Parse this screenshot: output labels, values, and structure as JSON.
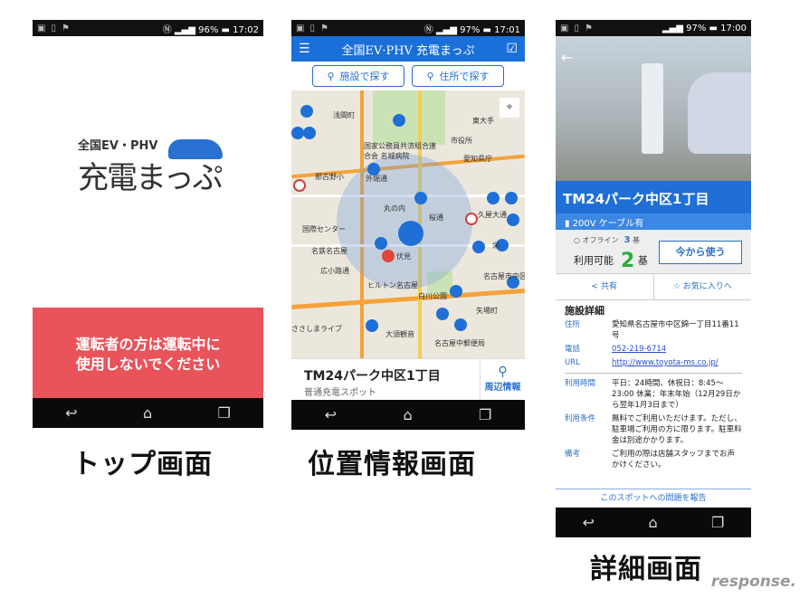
{
  "screens": {
    "top": {
      "status": {
        "battery": "96%",
        "time": "17:02"
      },
      "logo_small": "全国EV・PHV",
      "logo_big": "充電まっぷ",
      "warning": [
        "運転者の方は運転中に",
        "使用しないでください"
      ],
      "caption": "トップ画面"
    },
    "map": {
      "status": {
        "battery": "97%",
        "time": "17:01"
      },
      "header_title": "全国EV·PHV 充電まっぷ",
      "search_facility": "施設で探す",
      "search_address": "住所で探す",
      "map_labels": [
        "浅間町",
        "市役所",
        "国家公務員共済組合連合会 名城病院",
        "愛知県庁",
        "那古野小",
        "外堀通",
        "丸の内",
        "桜通",
        "久屋大通",
        "国際センター",
        "名鉄名古屋",
        "伏見",
        "広小路通",
        "名古屋市中区",
        "ヒルトン名古屋",
        "白川公園",
        "矢場町",
        "ささしまライブ",
        "大須観音",
        "名古屋中郵便局",
        "東大手",
        "栄"
      ],
      "spot_name": "TM24パーク中区1丁目",
      "spot_type": "普通充電スポット",
      "nearby": "周辺情報",
      "caption": "位置情報画面"
    },
    "detail": {
      "status": {
        "battery": "97%",
        "time": "17:00"
      },
      "title": "TM24パーク中区1丁目",
      "charger": "200V ケーブル有",
      "offline_label": "オフライン",
      "offline_count": "3",
      "unit": "基",
      "available_label": "利用可能",
      "available_count": "2",
      "use_now": "今から使う",
      "share": "共有",
      "favorite": "お気に入りへ",
      "section": "施設詳細",
      "rows": [
        {
          "k": "住所",
          "v": "愛知県名古屋市中区錦一丁目11番11号"
        },
        {
          "k": "電話",
          "v": "052-219-6714",
          "link": true
        },
        {
          "k": "URL",
          "v": "http://www.toyota-ms.co.jp/",
          "link": true
        },
        {
          "k": "利用時間",
          "v": "平日：24時間、休祝日：8:45〜23:00 休業：年末年始（12月29日から翌年1月3日まで）"
        },
        {
          "k": "利用条件",
          "v": "無料でご利用いただけます。ただし、駐車場ご利用の方に限ります。駐車料金は別途かかります。"
        },
        {
          "k": "備考",
          "v": "ご利用の際は店舗スタッフまでお声かけください。"
        }
      ],
      "report": "このスポットへの問題を報告",
      "caption": "詳細画面"
    }
  },
  "watermark": "response.",
  "colors": {
    "primary": "#1f6fd6",
    "warning": "#e9535a",
    "available": "#2faa3a"
  }
}
